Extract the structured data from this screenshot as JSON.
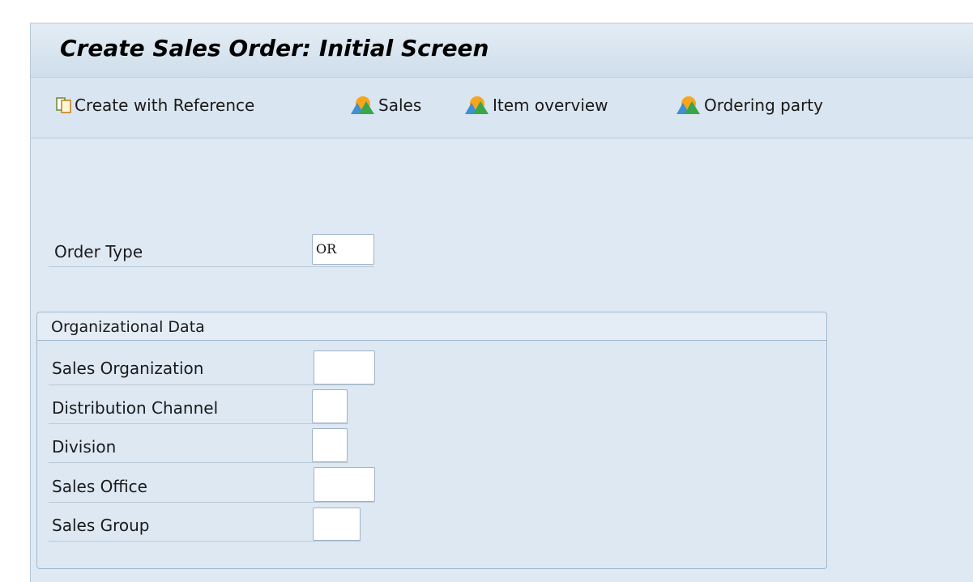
{
  "screen": {
    "title": "Create Sales Order: Initial Screen"
  },
  "toolbar": {
    "create_with_reference": {
      "label": "Create with Reference",
      "icon": "document-copy-icon"
    },
    "sales": {
      "label": "Sales",
      "icon": "overview-mountain-icon"
    },
    "item_overview": {
      "label": "Item overview",
      "icon": "overview-mountain-icon"
    },
    "ordering_party": {
      "label": "Ordering party",
      "icon": "overview-mountain-icon"
    }
  },
  "order_type": {
    "label": "Order Type",
    "value": "OR"
  },
  "org_data": {
    "title": "Organizational Data",
    "sales_organization": {
      "label": "Sales Organization",
      "value": ""
    },
    "distribution_channel": {
      "label": "Distribution Channel",
      "value": ""
    },
    "division": {
      "label": "Division",
      "value": ""
    },
    "sales_office": {
      "label": "Sales Office",
      "value": ""
    },
    "sales_group": {
      "label": "Sales Group",
      "value": ""
    }
  },
  "colors": {
    "background": "#dfe9f3",
    "title_bar": "#cfdeeb",
    "field_border": "#9fb3c6"
  }
}
